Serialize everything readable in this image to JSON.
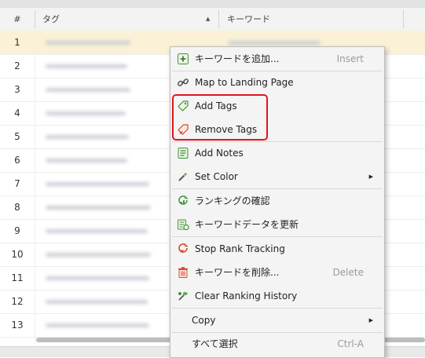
{
  "table": {
    "columns": {
      "index": "#",
      "tag": "タグ",
      "keyword": "キーワード"
    },
    "rows": [
      "1",
      "2",
      "3",
      "4",
      "5",
      "6",
      "7",
      "8",
      "9",
      "10",
      "11",
      "12",
      "13"
    ]
  },
  "context_menu": {
    "items": [
      {
        "label": "キーワードを追加...",
        "shortcut": "Insert",
        "icon": "add-keyword-icon"
      },
      {
        "label": "Map to Landing Page",
        "icon": "link-icon"
      },
      {
        "label": "Add Tags",
        "icon": "tag-icon"
      },
      {
        "label": "Remove Tags",
        "icon": "remove-tag-icon"
      },
      {
        "label": "Add Notes",
        "icon": "notes-icon"
      },
      {
        "label": "Set Color",
        "submenu": true,
        "icon": "color-picker-icon"
      },
      {
        "label": "ランキングの確認",
        "icon": "check-ranking-icon"
      },
      {
        "label": "キーワードデータを更新",
        "icon": "update-data-icon"
      },
      {
        "label": "Stop Rank Tracking",
        "icon": "stop-tracking-icon"
      },
      {
        "label": "キーワードを削除...",
        "shortcut": "Delete",
        "icon": "trash-icon"
      },
      {
        "label": "Clear Ranking History",
        "icon": "clear-history-icon"
      },
      {
        "label": "Copy",
        "submenu": true
      },
      {
        "label": "すべて選択",
        "shortcut": "Ctrl-A"
      }
    ]
  },
  "colors": {
    "selected_row": "#fbf1d6",
    "highlight_border": "#e0161c",
    "menu_background": "#f4f4f4",
    "icon_green": "#3f9a3f",
    "icon_red": "#d9472b"
  }
}
